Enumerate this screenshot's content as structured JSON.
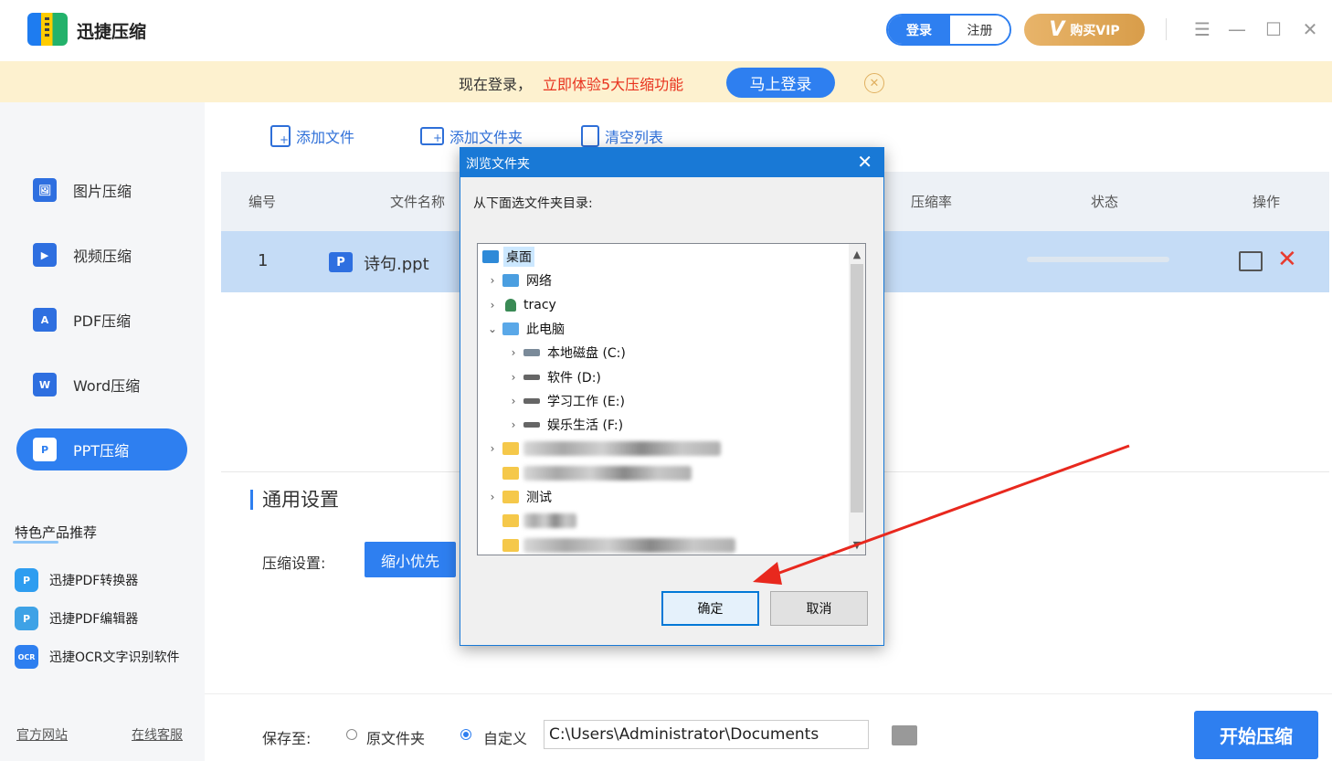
{
  "app": {
    "title": "迅捷压缩"
  },
  "header": {
    "login": "登录",
    "register": "注册",
    "vip": "购买VIP",
    "vip_mark": "V",
    "controls": [
      "☰",
      "—",
      "☐",
      "✕"
    ]
  },
  "banner": {
    "text": "现在登录，",
    "highlight": "立即体验5大压缩功能",
    "button": "马上登录",
    "close": "✕"
  },
  "sidebar": {
    "items": [
      {
        "label": "图片压缩",
        "icon": "image-icon",
        "glyph": "🖼"
      },
      {
        "label": "视频压缩",
        "icon": "video-icon",
        "glyph": "▶"
      },
      {
        "label": "PDF压缩",
        "icon": "pdf-icon",
        "glyph": "A"
      },
      {
        "label": "Word压缩",
        "icon": "word-icon",
        "glyph": "W"
      },
      {
        "label": "PPT压缩",
        "icon": "ppt-icon",
        "glyph": "P",
        "active": true
      }
    ],
    "recommend_title": "特色产品推荐",
    "recommend": [
      {
        "label": "迅捷PDF转换器",
        "glyph": "P"
      },
      {
        "label": "迅捷PDF编辑器",
        "glyph": "P"
      },
      {
        "label": "迅捷OCR文字识别软件",
        "glyph": "OCR"
      }
    ],
    "footer": {
      "official_site": "官方网站",
      "online_support": "在线客服"
    }
  },
  "toolbar": {
    "add_file": "添加文件",
    "add_folder": "添加文件夹",
    "clear_list": "清空列表"
  },
  "table": {
    "headers": {
      "number": "编号",
      "filename": "文件名称",
      "ratio": "压缩率",
      "status": "状态",
      "action": "操作"
    },
    "rows": [
      {
        "number": "1",
        "badge": "P",
        "name": "诗句.ppt"
      }
    ],
    "delete": "✕"
  },
  "settings": {
    "title": "通用设置",
    "label": "压缩设置:",
    "value": "缩小优先"
  },
  "save": {
    "label": "保存至:",
    "option_original": "原文件夹",
    "option_custom": "自定义",
    "path": "C:\\Users\\Administrator\\Documents",
    "start": "开始压缩"
  },
  "dialog": {
    "title": "浏览文件夹",
    "close": "✕",
    "prompt": "从下面选文件夹目录:",
    "tree": {
      "desktop": "桌面",
      "network": "网络",
      "user": "tracy",
      "this_pc": "此电脑",
      "drive_c": "本地磁盘 (C:)",
      "drive_d": "软件 (D:)",
      "drive_e": "学习工作 (E:)",
      "drive_f": "娱乐生活 (F:)",
      "test": "测试"
    },
    "ok": "确定",
    "cancel": "取消"
  },
  "colors": {
    "accent": "#2e7ff0",
    "banner_bg": "#fdf1cf",
    "highlight": "#e8331e",
    "vip": "#e0a859",
    "dialog_title": "#1979d6",
    "annotation": "#e8281e"
  }
}
